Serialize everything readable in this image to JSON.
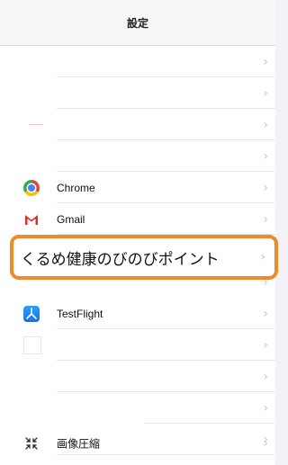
{
  "navbar": {
    "title": "設定"
  },
  "rows": [
    {
      "label": ""
    },
    {
      "label": ""
    },
    {
      "label": ""
    },
    {
      "label": ""
    },
    {
      "label": "Chrome",
      "icon": "chrome-icon"
    },
    {
      "label": "Gmail",
      "icon": "gmail-icon"
    },
    {
      "label": ""
    },
    {
      "label": "くるめ健康のびのびポイント"
    },
    {
      "label": "TestFlight",
      "icon": "testflight-icon"
    },
    {
      "label": ""
    },
    {
      "label": ""
    },
    {
      "label": ""
    },
    {
      "label": ""
    },
    {
      "label": "画像圧縮",
      "icon": "compress-icon"
    }
  ],
  "chevron": "›",
  "colors": {
    "accent_highlight": "#ef8a28",
    "separator": "#e5e5ea",
    "chevron": "#c7c7cc"
  }
}
